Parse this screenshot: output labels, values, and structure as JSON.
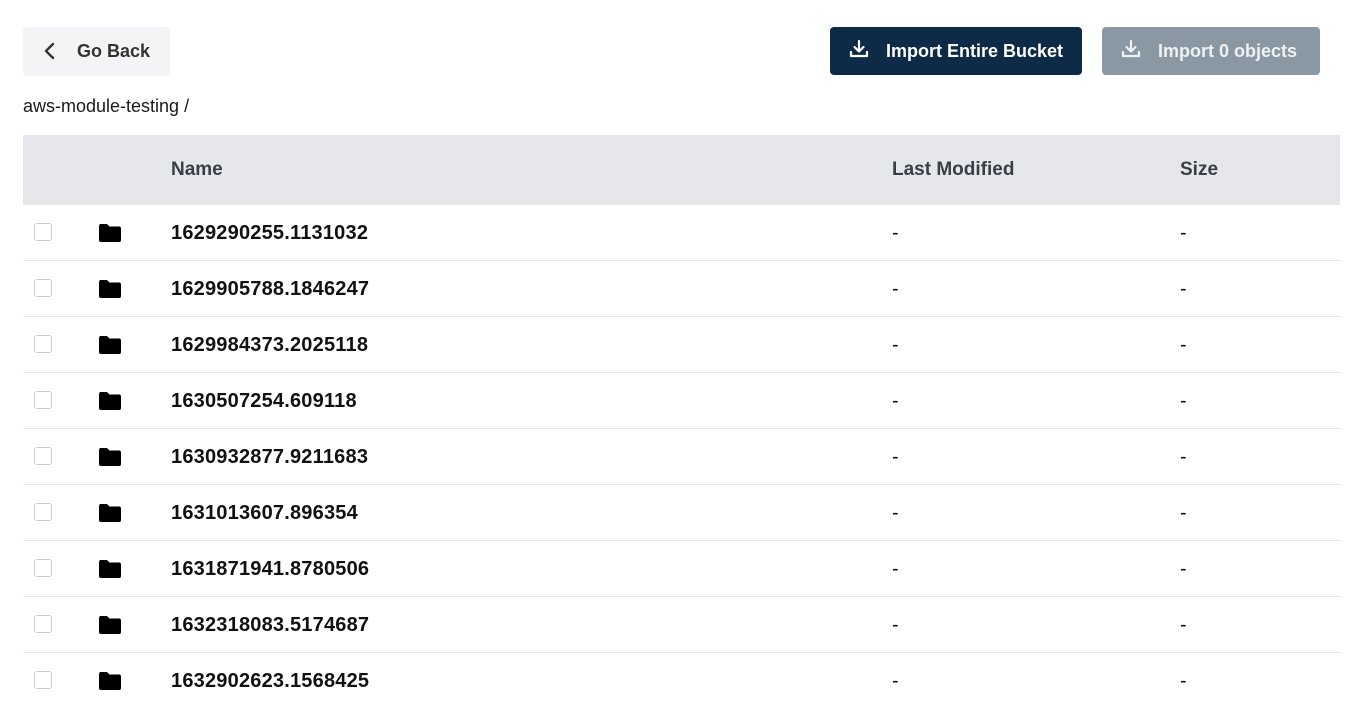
{
  "toolbar": {
    "go_back_label": "Go Back",
    "import_bucket_label": "Import Entire Bucket",
    "import_objects_label": "Import 0 objects",
    "import_bucket_color": "#0d2a47",
    "import_objects_color": "#8a98a4"
  },
  "breadcrumb": {
    "path": "aws-module-testing /"
  },
  "table": {
    "headers": {
      "name": "Name",
      "last_modified": "Last Modified",
      "size": "Size"
    },
    "rows": [
      {
        "name": "1629290255.1131032",
        "last_modified": "-",
        "size": "-",
        "icon": "folder-icon"
      },
      {
        "name": "1629905788.1846247",
        "last_modified": "-",
        "size": "-",
        "icon": "folder-icon"
      },
      {
        "name": "1629984373.2025118",
        "last_modified": "-",
        "size": "-",
        "icon": "folder-icon"
      },
      {
        "name": "1630507254.609118",
        "last_modified": "-",
        "size": "-",
        "icon": "folder-icon"
      },
      {
        "name": "1630932877.9211683",
        "last_modified": "-",
        "size": "-",
        "icon": "folder-icon"
      },
      {
        "name": "1631013607.896354",
        "last_modified": "-",
        "size": "-",
        "icon": "folder-icon"
      },
      {
        "name": "1631871941.8780506",
        "last_modified": "-",
        "size": "-",
        "icon": "folder-icon"
      },
      {
        "name": "1632318083.5174687",
        "last_modified": "-",
        "size": "-",
        "icon": "folder-icon"
      },
      {
        "name": "1632902623.1568425",
        "last_modified": "-",
        "size": "-",
        "icon": "folder-icon"
      }
    ]
  }
}
